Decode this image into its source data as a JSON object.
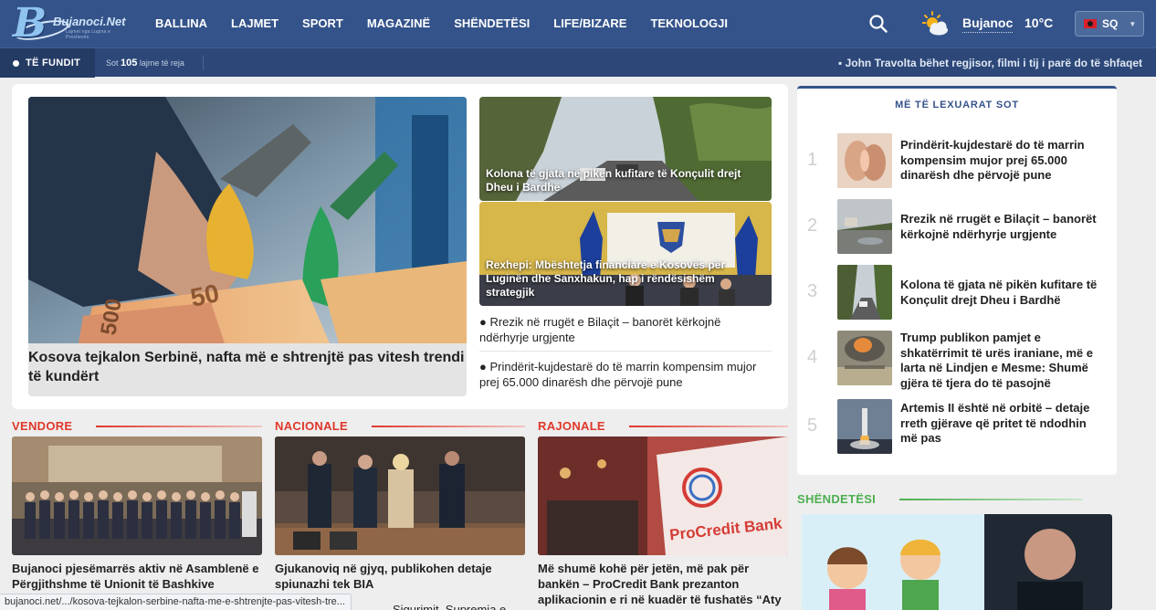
{
  "header": {
    "logo_text": "Bujanoci.Net",
    "logo_sub": "Lajmet nga Lugina e Preshevës",
    "nav": [
      "BALLINA",
      "LAJMET",
      "SPORT",
      "MAGAZINË",
      "SHËNDETËSI",
      "LIFE/BIZARE",
      "TEKNOLOGJI"
    ],
    "weather": {
      "city": "Bujanoc",
      "temp": "10°C",
      "icon": "partly-sunny-icon"
    },
    "language": {
      "code": "SQ",
      "flag": "albania-flag-icon"
    }
  },
  "ticker": {
    "label": "TË FUNDIT",
    "count_prefix": "Sot",
    "count": "105",
    "count_suffix": "lajme të reja",
    "headline": "John Travolta bëhet regjisor, filmi i tij i parë do të shfaqet"
  },
  "featured": {
    "main_title": "Kosova tejkalon Serbinë, nafta më e shtrenjtë pas vitesh trendi të kundërt",
    "side_stories": [
      "Kolona të gjata në pikën kufitare të Konçulit drejt Dheu i Bardhë",
      "Rexhepi: Mbështetja financiare e Kosovës për Luginën dhe Sanxhakun, hap i rëndësishëm strategjik"
    ],
    "bullets": [
      "● Rrezik në rrugët e Bilaçit – banorët kërkojnë ndërhyrje urgjente",
      "● Prindërit-kujdestarë do të marrin kompensim mujor prej 65.000 dinarësh dhe përvojë pune"
    ]
  },
  "sections": [
    {
      "title": "VENDORE",
      "headline": "Bujanoci pjesëmarrës aktiv në Asamblenë e Përgjithshme të Unionit të Bashkive"
    },
    {
      "title": "NACIONALE",
      "headline": "Gjukanoviq në gjyq, publikohen detaje spiunazhi tek BIA",
      "extra": "Sigurimit, Supremja e"
    },
    {
      "title": "RAJONALE",
      "headline": "Më shumë kohë për jetën, më pak për bankën – ProCredit Bank prezanton aplikacionin e ri në kuadër të fushatës “Aty",
      "image_text": "ProCredit Bank"
    }
  ],
  "most_read": {
    "title": "MË TË LEXUARAT SOT",
    "items": [
      {
        "rank": "1",
        "text": "Prindërit-kujdestarë do të marrin kompensim mujor prej 65.000 dinarësh dhe përvojë pune"
      },
      {
        "rank": "2",
        "text": "Rrezik në rrugët e Bilaçit – banorët kërkojnë ndërhyrje urgjente"
      },
      {
        "rank": "3",
        "text": "Kolona të gjata në pikën kufitare të Konçulit drejt Dheu i Bardhë"
      },
      {
        "rank": "4",
        "text": "Trump publikon pamjet e shkatërrimit të urës iraniane, më e larta në Lindjen e Mesme: Shumë gjëra të tjera do të pasojnë"
      },
      {
        "rank": "5",
        "text": "Artemis II është në orbitë – detaje rreth gjërave që pritet të ndodhin më pas"
      }
    ]
  },
  "health": {
    "title": "SHËNDETËSI"
  },
  "status_url": "bujanoci.net/.../kosova-tejkalon-serbine-nafta-me-e-shtrenjte-pas-vitesh-tre..."
}
